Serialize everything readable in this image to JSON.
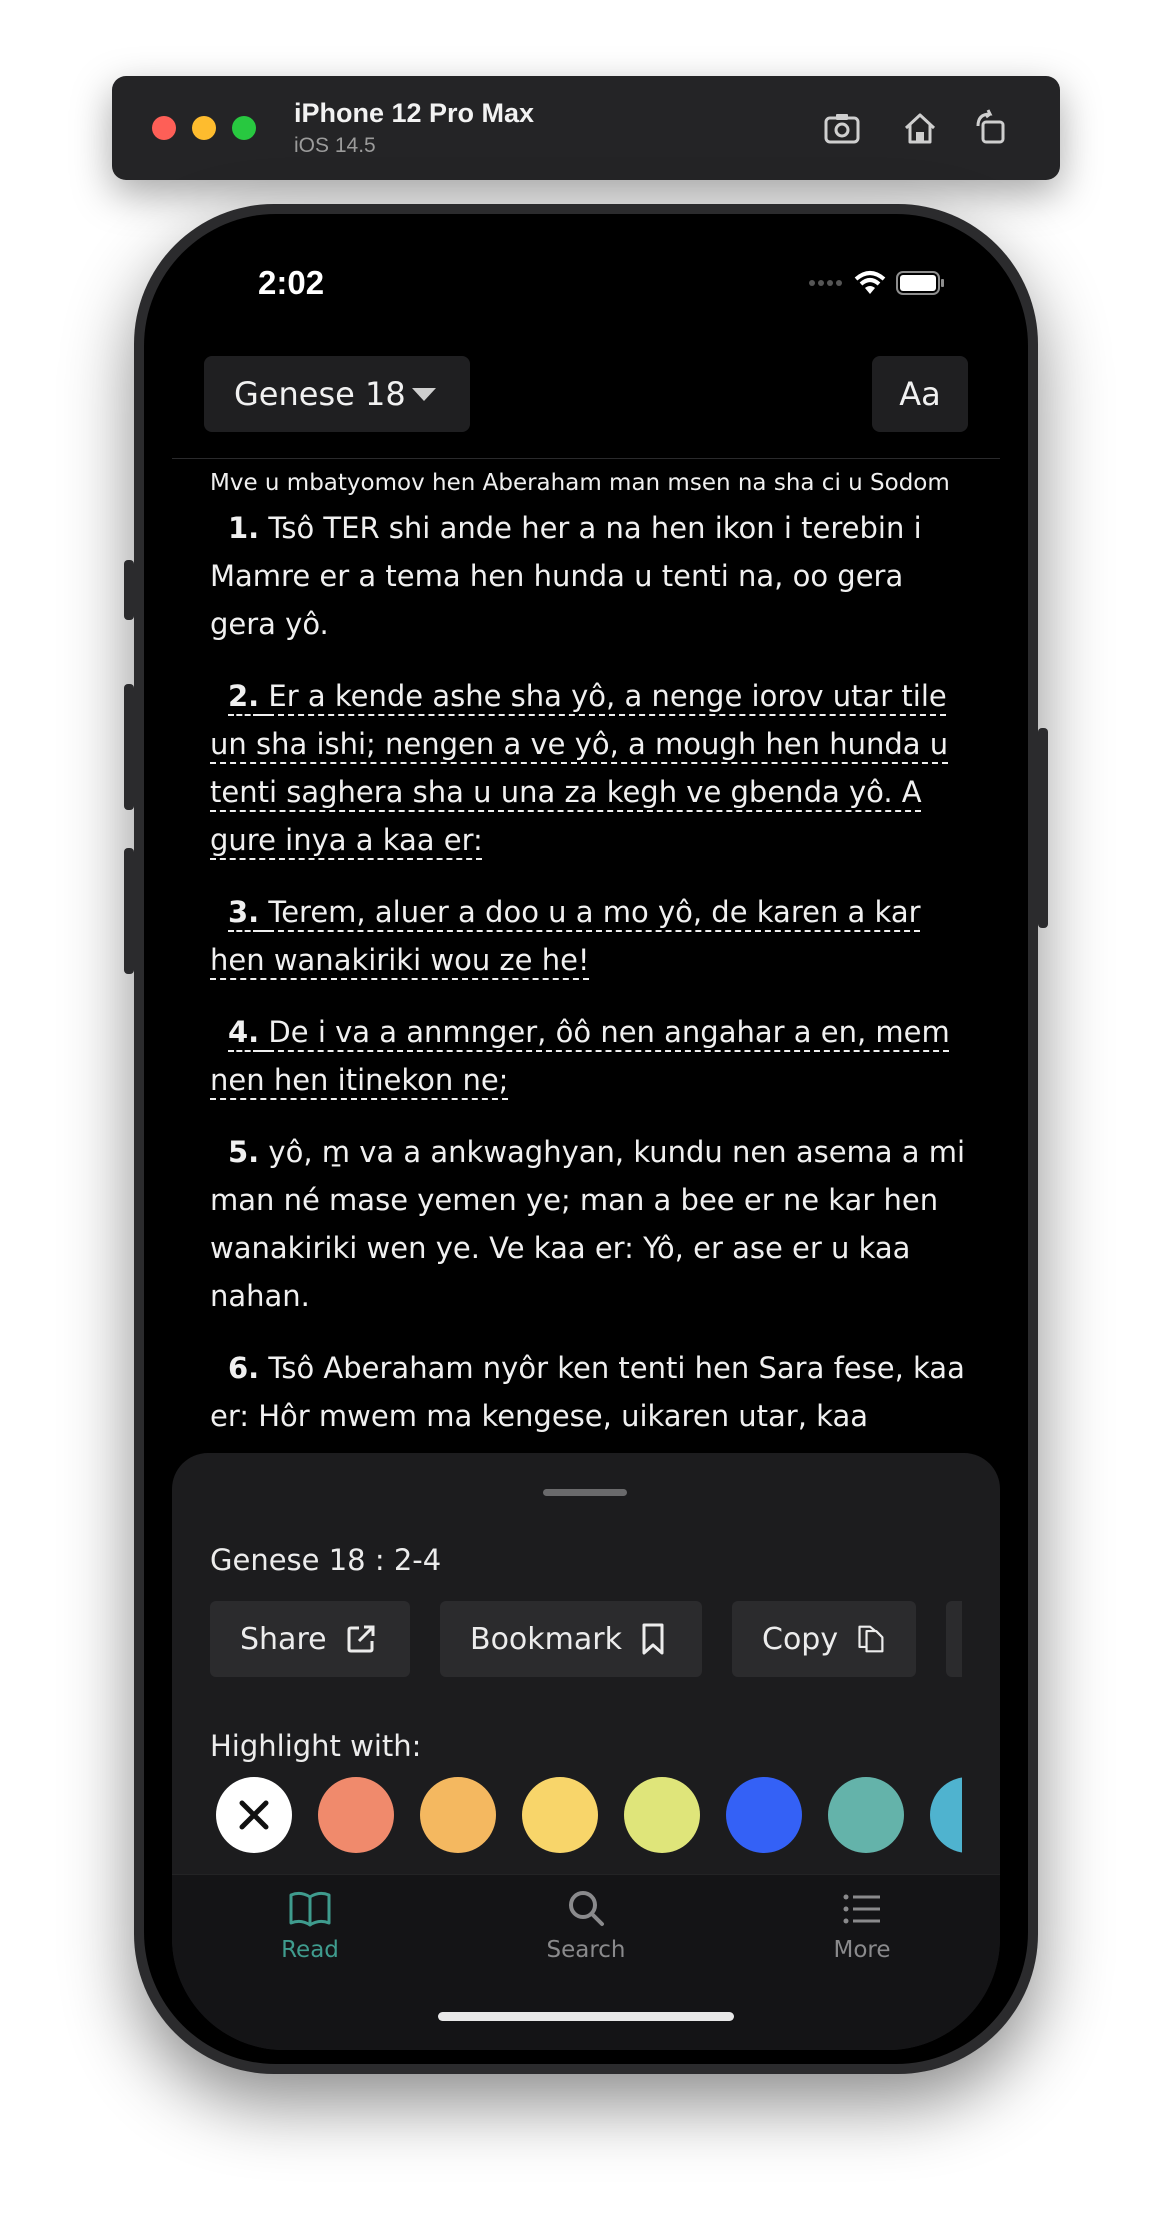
{
  "simulator": {
    "device_name": "iPhone 12 Pro Max",
    "os_version": "iOS 14.5",
    "tools": [
      "screenshot-icon",
      "home-icon",
      "rotate-icon"
    ]
  },
  "status_bar": {
    "time": "2:02"
  },
  "header": {
    "book_chapter": "Genese 18",
    "font_button": "Aa"
  },
  "reader": {
    "section_heading": "Mve u mbatyomov hen Aberaham man msen na sha ci u Sodom",
    "verses": [
      {
        "num": "1.",
        "text": "Tsô TER shi ande her a na hen ikon i terebin i Mamre er a tema hen hunda u tenti na, oo gera gera yô.",
        "selected": false
      },
      {
        "num": "2.",
        "text": "Er a kende ashe sha yô, a nenge iorov utar tile un sha ishi; nengen a ve yô, a mough hen hunda u tenti saghera sha u una za kegh ve gbenda yô. A gure inya a kaa er:",
        "selected": true
      },
      {
        "num": "3.",
        "text": "Terem, aluer a doo u a mo yô, de karen a kar hen wanakiriki wou ze he!",
        "selected": true
      },
      {
        "num": "4.",
        "text": "De i va a anmnger, ôô nen angahar a en, mem nen hen itinekon ne;",
        "selected": true
      },
      {
        "num": "5.",
        "text": "yô, m̱ va a ankwaghyan, kundu nen asema a mi man né mase yemen ye; man a bee er ne kar hen wanakiriki wen ye. Ve kaa er: Yô, er ase er u kaa nahan.",
        "selected": false
      },
      {
        "num": "6.",
        "text": "Tsô Aberaham nyôr ken tenti hen Sara fese, kaa er: Hôr mwem ma kengese, uikaren utar, kaa",
        "selected": false
      }
    ]
  },
  "sheet": {
    "reference": "Genese 18 : 2-4",
    "actions": [
      {
        "label": "Share",
        "icon": "share-icon"
      },
      {
        "label": "Bookmark",
        "icon": "bookmark-icon"
      },
      {
        "label": "Copy",
        "icon": "copy-icon"
      }
    ],
    "highlight_label": "Highlight with:",
    "colors": [
      "#ffffff",
      "#f08a6c",
      "#f4b860",
      "#f8d56a",
      "#dfe57a",
      "#3461f6",
      "#64b3aa",
      "#4fb3cf"
    ]
  },
  "tabs": [
    {
      "label": "Read",
      "icon": "book-icon",
      "active": true,
      "color": "#3f9c8e"
    },
    {
      "label": "Search",
      "icon": "search-icon",
      "active": false,
      "color": "#8a8a8c"
    },
    {
      "label": "More",
      "icon": "list-icon",
      "active": false,
      "color": "#8a8a8c"
    }
  ]
}
